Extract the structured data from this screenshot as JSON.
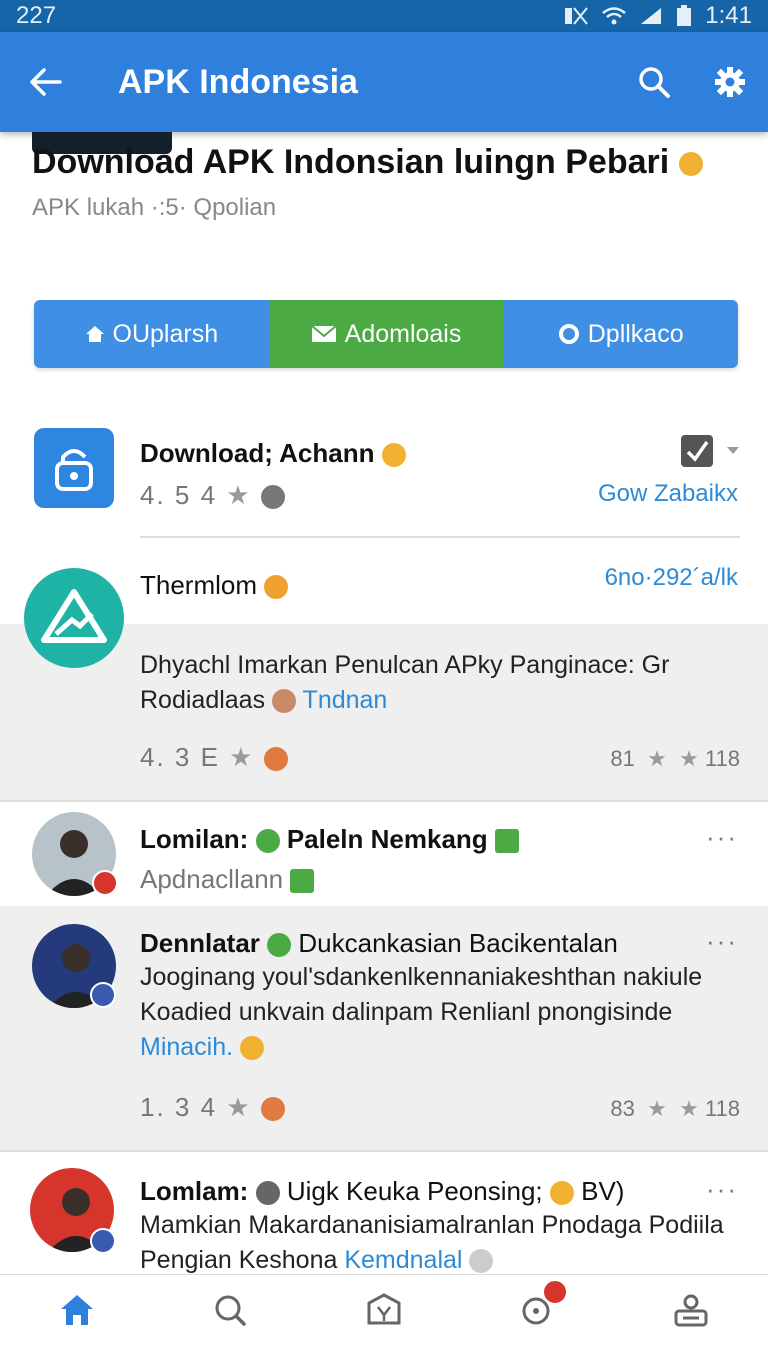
{
  "status": {
    "time_left": "227",
    "time_right": "1:41"
  },
  "appbar": {
    "title": "APK Indonesia"
  },
  "header": {
    "title": "Download APK Indonsian luingn Pebari",
    "subtitle": "APK lukah ·:5· Qpolian"
  },
  "tabs": [
    {
      "label": "OUplarsh"
    },
    {
      "label": "Adomloais"
    },
    {
      "label": "Dpllkaco"
    }
  ],
  "app1": {
    "name": "Download; Achann",
    "rating": "4. 5 4",
    "link": "Gow Zabaikx"
  },
  "app2": {
    "name": "Thermlom",
    "link": "6no·292´a/lk",
    "desc_main": "Dhyachl Imarkan Penulcan APky Panginace: Gr Rodiadlaas",
    "desc_link": "Tndnan",
    "rating": "4. 3 E",
    "count": "81",
    "count2": "118"
  },
  "post1": {
    "name": "Lomilan:",
    "name2": "Paleln Nemkang",
    "sub": "Apdnacllann"
  },
  "post2": {
    "name": "Dennlatar",
    "title": "Dukcankasian Bacikentalan",
    "body": "Jooginang youl'sdankenlkennaniakeshthan nakiule Koadied unkvain dalinpam Renlianl pnongisinde",
    "link": "Minacih.",
    "rating": "1. 3 4",
    "count": "83",
    "count2": "118"
  },
  "post3": {
    "name": "Lomlam:",
    "title": "Uigk Keuka Peonsing;",
    "tail": "BV)",
    "body": "Mamkian Makardananisiamalranlan Pnodaga Podiila Pengian Keshona",
    "link": "Kemdnalal"
  },
  "colors": {
    "appbar": "#2f80dc",
    "green": "#4caa45",
    "link": "#2c8ad6"
  },
  "dots": "···"
}
